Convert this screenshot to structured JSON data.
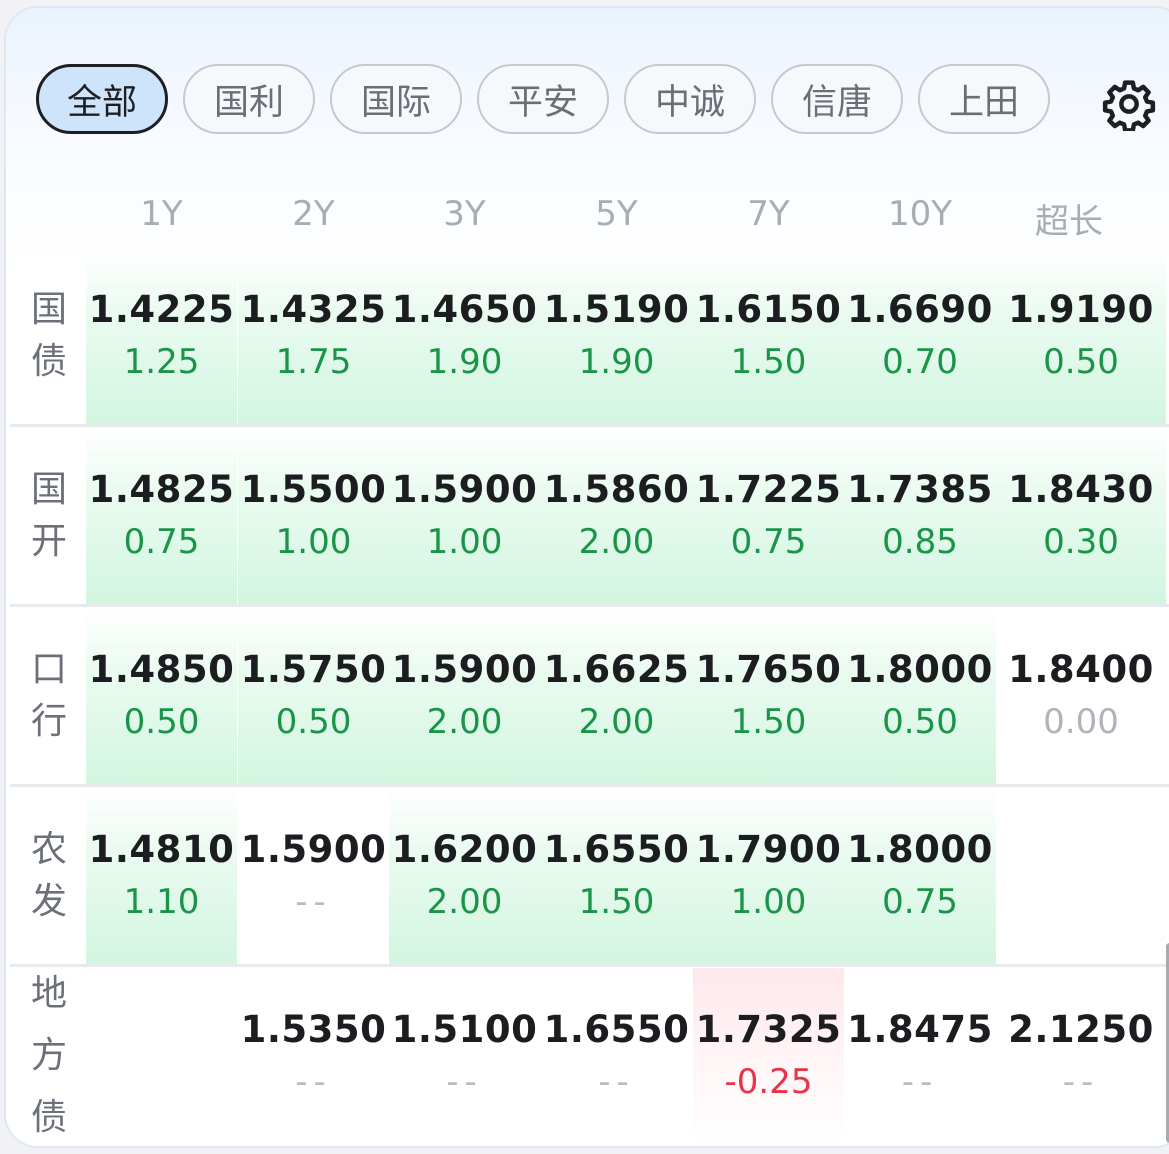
{
  "tabs": [
    "全部",
    "国利",
    "国际",
    "平安",
    "中诚",
    "信唐",
    "上田"
  ],
  "active_tab": 0,
  "settings_icon": "gear-icon",
  "columns": [
    "1Y",
    "2Y",
    "3Y",
    "5Y",
    "7Y",
    "10Y",
    "超长"
  ],
  "rows": [
    {
      "label": [
        "国",
        "债"
      ],
      "cells": [
        {
          "yield": "1.4225",
          "change": "1.25",
          "tone": "up"
        },
        {
          "yield": "1.4325",
          "change": "1.75",
          "tone": "up"
        },
        {
          "yield": "1.4650",
          "change": "1.90",
          "tone": "up"
        },
        {
          "yield": "1.5190",
          "change": "1.90",
          "tone": "up"
        },
        {
          "yield": "1.6150",
          "change": "1.50",
          "tone": "up"
        },
        {
          "yield": "1.6690",
          "change": "0.70",
          "tone": "up"
        },
        {
          "yield": "1.9190",
          "change": "0.50",
          "tone": "up"
        }
      ]
    },
    {
      "label": [
        "国",
        "开"
      ],
      "cells": [
        {
          "yield": "1.4825",
          "change": "0.75",
          "tone": "up"
        },
        {
          "yield": "1.5500",
          "change": "1.00",
          "tone": "up"
        },
        {
          "yield": "1.5900",
          "change": "1.00",
          "tone": "up"
        },
        {
          "yield": "1.5860",
          "change": "2.00",
          "tone": "up"
        },
        {
          "yield": "1.7225",
          "change": "0.75",
          "tone": "up"
        },
        {
          "yield": "1.7385",
          "change": "0.85",
          "tone": "up"
        },
        {
          "yield": "1.8430",
          "change": "0.30",
          "tone": "up"
        }
      ]
    },
    {
      "label": [
        "口",
        "行"
      ],
      "cells": [
        {
          "yield": "1.4850",
          "change": "0.50",
          "tone": "up"
        },
        {
          "yield": "1.5750",
          "change": "0.50",
          "tone": "up"
        },
        {
          "yield": "1.5900",
          "change": "2.00",
          "tone": "up"
        },
        {
          "yield": "1.6625",
          "change": "2.00",
          "tone": "up"
        },
        {
          "yield": "1.7650",
          "change": "1.50",
          "tone": "up"
        },
        {
          "yield": "1.8000",
          "change": "0.50",
          "tone": "up"
        },
        {
          "yield": "1.8400",
          "change": "0.00",
          "tone": "flat"
        }
      ]
    },
    {
      "label": [
        "农",
        "发"
      ],
      "cells": [
        {
          "yield": "1.4810",
          "change": "1.10",
          "tone": "up"
        },
        {
          "yield": "1.5900",
          "change": "--",
          "tone": "none"
        },
        {
          "yield": "1.6200",
          "change": "2.00",
          "tone": "up"
        },
        {
          "yield": "1.6550",
          "change": "1.50",
          "tone": "up"
        },
        {
          "yield": "1.7900",
          "change": "1.00",
          "tone": "up"
        },
        {
          "yield": "1.8000",
          "change": "0.75",
          "tone": "up"
        },
        {
          "yield": "",
          "change": "",
          "tone": "empty"
        }
      ]
    },
    {
      "label": [
        "地",
        "方",
        "债"
      ],
      "cells": [
        {
          "yield": "",
          "change": "",
          "tone": "empty"
        },
        {
          "yield": "1.5350",
          "change": "--",
          "tone": "none"
        },
        {
          "yield": "1.5100",
          "change": "--",
          "tone": "none"
        },
        {
          "yield": "1.6550",
          "change": "--",
          "tone": "none"
        },
        {
          "yield": "1.7325",
          "change": "-0.25",
          "tone": "down"
        },
        {
          "yield": "1.8475",
          "change": "--",
          "tone": "none"
        },
        {
          "yield": "2.1250",
          "change": "--",
          "tone": "none"
        }
      ]
    }
  ],
  "colors": {
    "up": "#1a9449",
    "down": "#e8334a",
    "flat": "#b0b4ba",
    "active_tab_bg": "#cde4fb"
  }
}
